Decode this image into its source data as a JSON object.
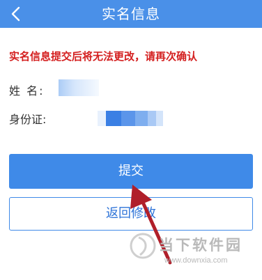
{
  "header": {
    "title": "实名信息",
    "background": "#4a90e8",
    "back_icon": "chevron-left-icon"
  },
  "notice": {
    "text": "实名信息提交后将无法更改，请再次确认",
    "color": "#d42020"
  },
  "form": {
    "name_label": "姓  名:",
    "id_label": "身份证:"
  },
  "buttons": {
    "submit_label": "提交",
    "back_label": "返回修改",
    "accent": "#3f8ae8"
  },
  "watermark": {
    "brand": "当下软件园",
    "url": "www.downxia.com"
  }
}
